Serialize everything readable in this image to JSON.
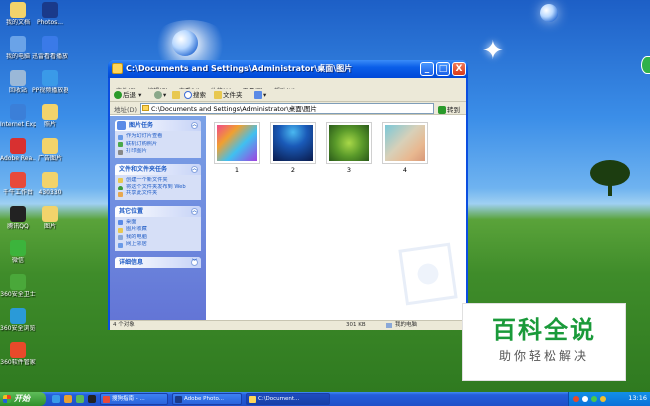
{
  "desktop": {
    "icons_col1": [
      {
        "label": "我的文档",
        "color": "#f2d36b"
      },
      {
        "label": "我的电脑",
        "color": "#6aa3e8"
      },
      {
        "label": "回收站",
        "color": "#9ab8d8"
      },
      {
        "label": "Internet Explorer",
        "color": "#3b7fd8"
      },
      {
        "label": "Adobe Rea...",
        "color": "#d83030"
      },
      {
        "label": "千牛工作台",
        "color": "#e84a3a"
      },
      {
        "label": "腾讯QQ",
        "color": "#222222"
      },
      {
        "label": "微信",
        "color": "#3cb43c"
      },
      {
        "label": "360安全卫士",
        "color": "#4aa83a"
      },
      {
        "label": "360安全浏览器",
        "color": "#2a9ad8"
      },
      {
        "label": "360软件管家",
        "color": "#e84a2a"
      }
    ],
    "icons_col2": [
      {
        "label": "Photos...",
        "color": "#1a3a8a"
      },
      {
        "label": "迅雷看看播放器",
        "color": "#3a7ae8"
      },
      {
        "label": "PP视频播放器",
        "color": "#3a9ae8"
      },
      {
        "label": "照片",
        "color": "#f2d36b"
      },
      {
        "label": "广告图片",
        "color": "#f2d36b"
      },
      {
        "label": "430330",
        "color": "#f2d36b"
      },
      {
        "label": "图片",
        "color": "#f2d36b"
      }
    ]
  },
  "window": {
    "title": "C:\\Documents and Settings\\Administrator\\桌面\\图片",
    "minimize": "_",
    "maximize": "□",
    "close": "X",
    "menu": [
      "文件(F)",
      "编辑(E)",
      "查看(V)",
      "收藏(A)",
      "工具(T)",
      "帮助(H)"
    ],
    "toolbar": {
      "back": "后退",
      "search": "搜索",
      "folders": "文件夹"
    },
    "address": {
      "label": "地址(D)",
      "value": "C:\\Documents and Settings\\Administrator\\桌面\\图片",
      "go": "转到"
    },
    "panels": [
      {
        "title": "图片任务",
        "items": [
          "作为幻灯片查看",
          "联机订购照片",
          "打印图片"
        ]
      },
      {
        "title": "文件和文件夹任务",
        "items": [
          "创建一个新文件夹",
          "将这个文件夹发布到 Web",
          "共享此文件夹"
        ]
      },
      {
        "title": "其它位置",
        "items": [
          "桌面",
          "图片收藏",
          "我的电脑",
          "网上邻居"
        ]
      },
      {
        "title": "详细信息",
        "items": []
      }
    ],
    "thumbnails": [
      {
        "label": "1"
      },
      {
        "label": "2"
      },
      {
        "label": "3"
      },
      {
        "label": "4"
      }
    ],
    "status": {
      "count": "4 个对象",
      "size": "301 KB",
      "location": "我的电脑"
    }
  },
  "watermark": {
    "title": "百科全说",
    "subtitle": "助你轻松解决"
  },
  "taskbar": {
    "start": "开始",
    "tasks": [
      "搜狗指南 - ...",
      "Adobe Photo...",
      "C:\\Document..."
    ],
    "clock": "13:16"
  }
}
